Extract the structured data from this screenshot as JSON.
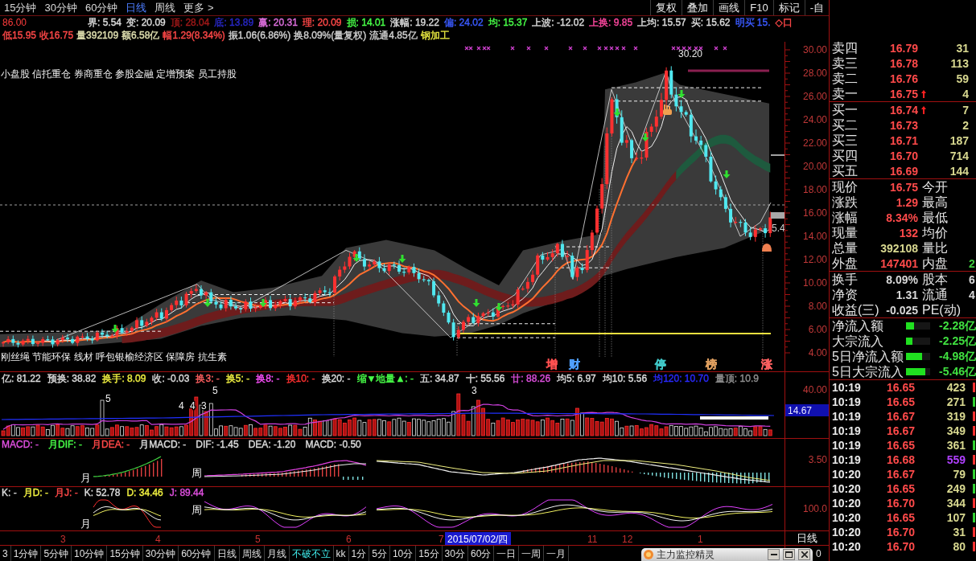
{
  "period_tabs": [
    {
      "label": "15分钟",
      "selected": false
    },
    {
      "label": "30分钟",
      "selected": false
    },
    {
      "label": "60分钟",
      "selected": false
    },
    {
      "label": "日线",
      "selected": true
    },
    {
      "label": "周线",
      "selected": false
    },
    {
      "label": "更多 >",
      "selected": false
    }
  ],
  "toolbar_buttons": [
    "复权",
    "叠加",
    "画线",
    "F10",
    "标记",
    "-自"
  ],
  "quote_line": {
    "price": "86.00",
    "items": [
      {
        "text": "界: 5.54",
        "color": "#dcdcdc"
      },
      {
        "text": "变: 20.09",
        "color": "#dcdcdc"
      },
      {
        "text": "顶: 28.04",
        "color": "#a01818"
      },
      {
        "text": "底: 13.89",
        "color": "#2828c8"
      },
      {
        "text": "赢: 20.31",
        "color": "#e070e0"
      },
      {
        "text": "理: 20.09",
        "color": "#ff4848"
      },
      {
        "text": "损: 14.01",
        "color": "#48ff48"
      },
      {
        "text": "涨幅: 19.22",
        "color": "#dcdcdc"
      },
      {
        "text": "偏: 24.02",
        "color": "#3a5aff"
      },
      {
        "text": "均: 15.37",
        "color": "#48ff48"
      },
      {
        "text": "上波: -12.02",
        "color": "#dcdcdc"
      },
      {
        "text": "上换: 9.85",
        "color": "#ff48a0"
      },
      {
        "text": "上均: 15.57",
        "color": "#dcdcdc"
      },
      {
        "text": "买: 15.62",
        "color": "#dcdcdc"
      },
      {
        "text": "明买 15.",
        "color": "#3a5aff"
      },
      {
        "text": "◇口",
        "color": "#ff4848"
      }
    ]
  },
  "summary_line": [
    {
      "text": "低15.95",
      "color": "#ff4848"
    },
    {
      "text": "收16.75",
      "color": "#ff4848"
    },
    {
      "text": "量392109",
      "color": "#e0e0b0"
    },
    {
      "text": "额6.58亿",
      "color": "#e0e0b0"
    },
    {
      "text": "幅1.29(8.34%)",
      "color": "#ff4848"
    },
    {
      "text": "振1.06(6.86%)",
      "color": "#d0d0d0"
    },
    {
      "text": "换8.09%(量复权)",
      "color": "#d0d0d0"
    },
    {
      "text": "流通4.85亿",
      "color": "#d0d0d0"
    },
    {
      "text": "钢加工",
      "color": "#e8e840"
    }
  ],
  "main_chart": {
    "concept_tags": "小盘股 信托重仓 券商重仓 参股金融 定增预案 员工持股",
    "industry_tags": "刚丝绳 节能环保 线材 呼包银榆经济区 保障房 抗生素",
    "peak_label": "30.20",
    "edge_label": "5.4",
    "signals": [
      {
        "text": "增",
        "color": "#ff5050"
      },
      {
        "text": "财",
        "color": "#50a0ff"
      },
      {
        "text": "停",
        "color": "#40c8c8"
      },
      {
        "text": "榜",
        "color": "#e0a060"
      },
      {
        "text": "涨",
        "color": "#ff6060"
      }
    ],
    "price_axis": [
      "30.00",
      "28.00",
      "26.00",
      "24.00",
      "22.00",
      "20.00",
      "18.00",
      "16.00",
      "14.00",
      "12.00",
      "10.00",
      "8.00",
      "6.00",
      "4.00"
    ]
  },
  "volume_panel": {
    "items": [
      {
        "text": "亿: 81.22",
        "color": "#dcdcdc"
      },
      {
        "text": "预换: 38.82",
        "color": "#dcdcdc"
      },
      {
        "text": "换手: 8.09",
        "color": "#f0f040"
      },
      {
        "text": "收: -0.03",
        "color": "#dcdcdc"
      },
      {
        "text": "换3: -",
        "color": "#ff6060"
      },
      {
        "text": "换5: -",
        "color": "#f0f040"
      },
      {
        "text": "换8: -",
        "color": "#ff50ff"
      },
      {
        "text": "换10: -",
        "color": "#ff3030"
      },
      {
        "text": "换20: -",
        "color": "#dcdcdc"
      },
      {
        "text": "缩▼地量▲: -",
        "color": "#48ff48"
      },
      {
        "text": "五: 34.87",
        "color": "#dcdcdc"
      },
      {
        "text": "十: 55.56",
        "color": "#dcdcdc"
      },
      {
        "text": "廿: 88.26",
        "color": "#e050e0"
      },
      {
        "text": "均5: 6.97",
        "color": "#dcdcdc"
      },
      {
        "text": "均10: 5.56",
        "color": "#dcdcdc"
      },
      {
        "text": "均120: 10.70",
        "color": "#2a2aff"
      },
      {
        "text": "量顶: 10.9",
        "color": "#909090"
      }
    ],
    "bar_labels": [
      "5",
      "3",
      "5",
      "4",
      "4",
      "3"
    ],
    "axis_label": "40.00",
    "current_value": "14.67"
  },
  "macd_panel": {
    "items": [
      {
        "text": "MACD: -",
        "color": "#e050e0"
      },
      {
        "text": "月DIF: -",
        "color": "#48ff48"
      },
      {
        "text": "月DEA: -",
        "color": "#ff4848"
      },
      {
        "text": "月MACD: -",
        "color": "#dcdcdc"
      },
      {
        "text": "DIF: -1.45",
        "color": "#dcdcdc"
      },
      {
        "text": "DEA: -1.20",
        "color": "#dcdcdc"
      },
      {
        "text": "MACD: -0.50",
        "color": "#dcdcdc"
      }
    ],
    "segment_labels": [
      "月",
      "周"
    ],
    "axis_label": "3.50"
  },
  "kdj_panel": {
    "items": [
      {
        "text": "K: -",
        "color": "#dcdcdc"
      },
      {
        "text": "月D: -",
        "color": "#f0f040"
      },
      {
        "text": "月J: -",
        "color": "#ff4848"
      },
      {
        "text": "K: 52.78",
        "color": "#dcdcdc"
      },
      {
        "text": "D: 34.46",
        "color": "#f0f040"
      },
      {
        "text": "J: 89.44",
        "color": "#e050e0"
      }
    ],
    "segment_labels": [
      "月",
      "周"
    ],
    "axis_label": "100.0"
  },
  "date_axis": {
    "labels": [
      {
        "text": "3",
        "kind": "month"
      },
      {
        "text": "4",
        "kind": "month"
      },
      {
        "text": "5",
        "kind": "month"
      },
      {
        "text": "6",
        "kind": "month"
      },
      {
        "text": "7",
        "kind": "month"
      },
      {
        "text": "2015/07/02/四",
        "kind": "cursor"
      },
      {
        "text": "11",
        "kind": "month"
      },
      {
        "text": "12",
        "kind": "month"
      },
      {
        "text": "1",
        "kind": "month"
      }
    ],
    "period": "日线"
  },
  "bottom_tabs": [
    {
      "label": "3",
      "selected": false
    },
    {
      "label": "1分钟",
      "selected": false
    },
    {
      "label": "5分钟",
      "selected": false
    },
    {
      "label": "10分钟",
      "selected": false
    },
    {
      "label": "15分钟",
      "selected": false
    },
    {
      "label": "30分钟",
      "selected": false
    },
    {
      "label": "60分钟",
      "selected": false
    },
    {
      "label": "日线",
      "selected": false
    },
    {
      "label": "周线",
      "selected": false
    },
    {
      "label": "月线",
      "selected": false
    },
    {
      "label": "不破不立",
      "selected": true
    },
    {
      "label": "kk",
      "selected": false
    },
    {
      "label": "1分",
      "selected": false
    },
    {
      "label": "5分",
      "selected": false
    },
    {
      "label": "10分",
      "selected": false
    },
    {
      "label": "15分",
      "selected": false
    },
    {
      "label": "30分",
      "selected": false
    },
    {
      "label": "60分",
      "selected": false
    },
    {
      "label": "一日",
      "selected": false
    },
    {
      "label": "一周",
      "selected": false
    },
    {
      "label": "一月",
      "selected": false
    }
  ],
  "bottom_corner": "0",
  "popup": {
    "title": "主力监控精灵"
  },
  "order_book": [
    {
      "label": "卖四",
      "price": "16.79",
      "volume": "31",
      "up_arrow": false
    },
    {
      "label": "卖三",
      "price": "16.78",
      "volume": "113",
      "up_arrow": false
    },
    {
      "label": "卖二",
      "price": "16.76",
      "volume": "59",
      "up_arrow": false
    },
    {
      "label": "卖一",
      "price": "16.75",
      "volume": "4",
      "up_arrow": true
    },
    {
      "label": "买一",
      "price": "16.74",
      "volume": "7",
      "up_arrow": true
    },
    {
      "label": "买二",
      "price": "16.73",
      "volume": "2",
      "up_arrow": false
    },
    {
      "label": "买三",
      "price": "16.71",
      "volume": "187",
      "up_arrow": false
    },
    {
      "label": "买四",
      "price": "16.70",
      "volume": "714",
      "up_arrow": false
    },
    {
      "label": "买五",
      "price": "16.69",
      "volume": "144",
      "up_arrow": false
    }
  ],
  "quote_table": [
    {
      "label": "现价",
      "value": "16.75",
      "color": "#ff4a4a",
      "label2": "今开"
    },
    {
      "label": "涨跌",
      "value": "1.29",
      "color": "#ff4a4a",
      "label2": "最高"
    },
    {
      "label": "涨幅",
      "value": "8.34%",
      "color": "#ff4a4a",
      "label2": "最低"
    },
    {
      "label": "现量",
      "value": "132",
      "color": "#ff4a4a",
      "label2": "均价"
    },
    {
      "label": "总量",
      "value": "392108",
      "color": "#d8d890",
      "label2": "量比"
    },
    {
      "label": "外盘",
      "value": "147401",
      "color": "#ff4a4a",
      "label2": "内盘",
      "value2": {
        "text": "2",
        "color": "#3cc83c"
      }
    }
  ],
  "fundamentals": [
    {
      "label": "换手",
      "value": "8.09%",
      "label2": "股本",
      "value2": "6"
    },
    {
      "label": "净资",
      "value": "1.31",
      "label2": "流通",
      "value2": "4"
    },
    {
      "label": "收益(三)",
      "value": "-0.025",
      "label2": "PE(动)"
    }
  ],
  "fund_flow": [
    {
      "label": "净流入额",
      "level": 0.33,
      "value": "-2.28亿"
    },
    {
      "label": "大宗流入",
      "level": 0.27,
      "value": "-2.25亿"
    },
    {
      "label": "5日净流入额",
      "level": 0.67,
      "value": "-4.98亿"
    },
    {
      "label": "5日大宗流入",
      "level": 0.8,
      "value": "-5.46亿"
    }
  ],
  "trades": [
    {
      "time": "10:19",
      "price": "16.65",
      "volume": "423",
      "large": false,
      "color": "#ff3030"
    },
    {
      "time": "10:19",
      "price": "16.65",
      "volume": "271",
      "large": false,
      "color": "#30d030"
    },
    {
      "time": "10:19",
      "price": "16.67",
      "volume": "319",
      "large": false,
      "color": "#ff3030"
    },
    {
      "time": "10:19",
      "price": "16.67",
      "volume": "349",
      "large": false,
      "color": "#ff3030"
    },
    {
      "time": "10:19",
      "price": "16.65",
      "volume": "361",
      "large": false,
      "color": "#30d030"
    },
    {
      "time": "10:19",
      "price": "16.68",
      "volume": "559",
      "large": true,
      "color": "#ff3030"
    },
    {
      "time": "10:20",
      "price": "16.67",
      "volume": "79",
      "large": false,
      "color": "#30d030"
    },
    {
      "time": "10:20",
      "price": "16.65",
      "volume": "249",
      "large": false,
      "color": "#30d030"
    },
    {
      "time": "10:20",
      "price": "16.70",
      "volume": "344",
      "large": false,
      "color": "#ff3030"
    },
    {
      "time": "10:20",
      "price": "16.65",
      "volume": "107",
      "large": false,
      "color": "#30d030"
    },
    {
      "time": "10:20",
      "price": "16.70",
      "volume": "31",
      "large": false,
      "color": "#ff3030"
    },
    {
      "time": "10:20",
      "price": "16.70",
      "volume": "80",
      "large": false,
      "color": "#ff3030"
    }
  ]
}
